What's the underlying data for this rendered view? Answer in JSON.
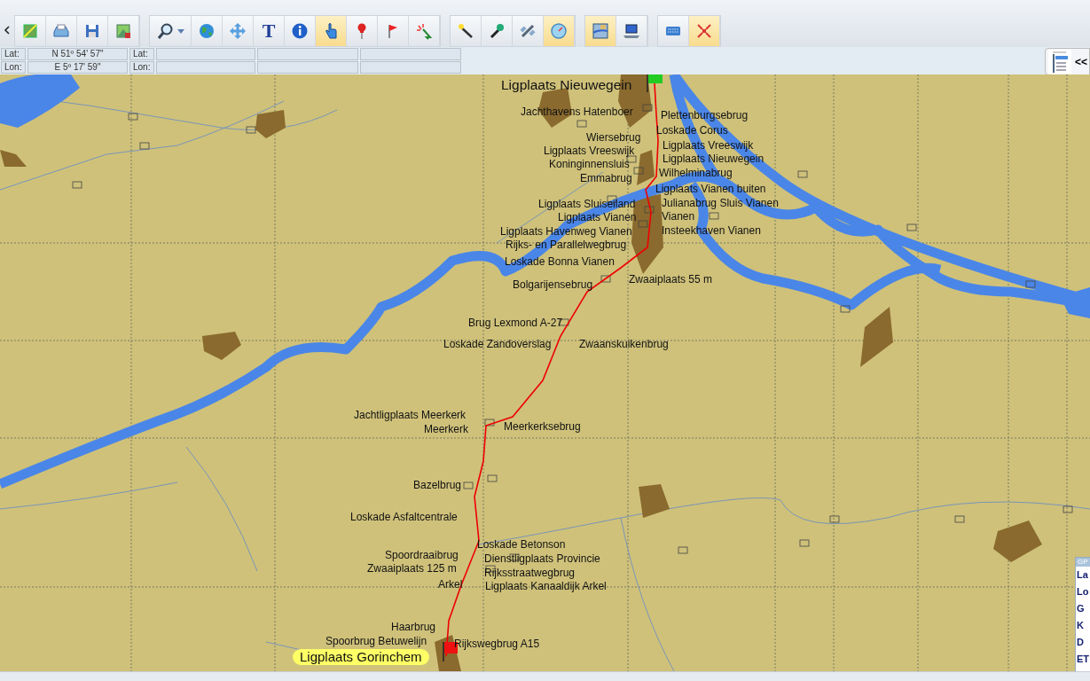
{
  "toolbar": {
    "groups": [
      [
        {
          "selected": false
        },
        {
          "selected": false
        },
        {
          "selected": false
        },
        {
          "selected": false
        }
      ],
      [
        {
          "selected": false
        },
        {
          "selected": false
        },
        {
          "selected": false
        },
        {
          "label": "T",
          "selected": false
        },
        {
          "selected": false
        },
        {
          "selected": true
        },
        {
          "selected": false
        },
        {
          "selected": false
        },
        {
          "selected": false
        }
      ],
      [
        {
          "selected": false
        },
        {
          "selected": false
        },
        {
          "selected": false
        },
        {
          "selected": true
        }
      ],
      [
        {
          "selected": true
        },
        {
          "selected": false
        }
      ],
      [
        {
          "selected": false
        },
        {
          "selected": true
        }
      ]
    ]
  },
  "coordinates": {
    "rows": [
      {
        "label": "Lat:",
        "value": "N 51º 54' 57\"",
        "label_2": "Lat:"
      },
      {
        "label": "Lon:",
        "value": "E 5º 17' 59\"",
        "label_2": "Lon:"
      }
    ]
  },
  "side_panel": {
    "button": "<<"
  },
  "map": {
    "labels": [
      {
        "text": "Ligplaats Nieuwegein",
        "kind": "title"
      },
      {
        "text": "Jachthavens Hatenboer",
        "kind": "plain"
      },
      {
        "text": "Plettenburgsebrug",
        "kind": "plain"
      },
      {
        "text": "Loskade Corus",
        "kind": "plain"
      },
      {
        "text": "Wiersebrug",
        "kind": "plain"
      },
      {
        "text": "Ligplaats Vreeswijk",
        "kind": "plain"
      },
      {
        "text": "Ligplaats Vreeswijk",
        "kind": "plain"
      },
      {
        "text": "Ligplaats Nieuwegein",
        "kind": "plain"
      },
      {
        "text": "Koninginnensluis",
        "kind": "plain"
      },
      {
        "text": "Wilhelminabrug",
        "kind": "plain"
      },
      {
        "text": "Emmabrug",
        "kind": "plain"
      },
      {
        "text": "Ligplaats Vianen buiten",
        "kind": "plain"
      },
      {
        "text": "Ligplaats Sluiseiland",
        "kind": "plain"
      },
      {
        "text": "Julianabrug Sluis Vianen",
        "kind": "plain"
      },
      {
        "text": "Ligplaats Vianen",
        "kind": "plain"
      },
      {
        "text": "Vianen",
        "kind": "plain"
      },
      {
        "text": "Ligplaats Havenweg Vianen",
        "kind": "plain"
      },
      {
        "text": "Insteekhaven Vianen",
        "kind": "plain"
      },
      {
        "text": "Rijks- en Parallelwegbrug",
        "kind": "plain"
      },
      {
        "text": "Loskade Bonna Vianen",
        "kind": "plain"
      },
      {
        "text": "Bolgarijensebrug",
        "kind": "plain"
      },
      {
        "text": "Zwaaiplaats 55 m",
        "kind": "plain"
      },
      {
        "text": "Brug Lexmond A-27",
        "kind": "plain"
      },
      {
        "text": "Loskade Zandoverslag",
        "kind": "plain"
      },
      {
        "text": "Zwaanskuikenbrug",
        "kind": "plain"
      },
      {
        "text": "Jachtligplaats Meerkerk",
        "kind": "plain"
      },
      {
        "text": "Meerkerk",
        "kind": "plain"
      },
      {
        "text": "Meerkerksebrug",
        "kind": "plain"
      },
      {
        "text": "Bazelbrug",
        "kind": "plain"
      },
      {
        "text": "Loskade Asfaltcentrale",
        "kind": "plain"
      },
      {
        "text": "Loskade Betonson",
        "kind": "plain"
      },
      {
        "text": "Spoordraaibrug",
        "kind": "plain"
      },
      {
        "text": "Dienstligplaats Provincie",
        "kind": "plain"
      },
      {
        "text": "Zwaaiplaats 125 m",
        "kind": "plain"
      },
      {
        "text": "Rijksstraatwegbrug",
        "kind": "plain"
      },
      {
        "text": "Arkel",
        "kind": "plain"
      },
      {
        "text": "Ligplaats Kanaaldijk Arkel",
        "kind": "plain"
      },
      {
        "text": "Haarbrug",
        "kind": "plain"
      },
      {
        "text": "Spoorbrug Betuwelijn",
        "kind": "plain"
      },
      {
        "text": "Rijkswegbrug A15",
        "kind": "plain"
      },
      {
        "text": "Ligplaats Gorinchem",
        "kind": "highlight"
      }
    ]
  },
  "gps_panel": {
    "title": "GP",
    "rows": [
      "La",
      "Lo",
      "G",
      "K",
      "D",
      "ET"
    ]
  }
}
